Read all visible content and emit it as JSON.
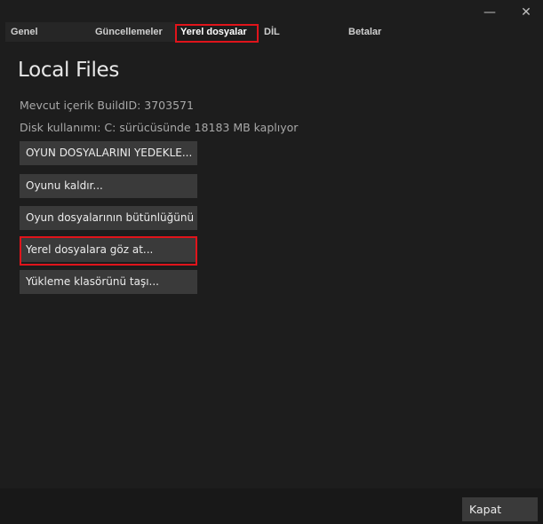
{
  "window": {
    "minimize_glyph": "—",
    "close_glyph": "✕"
  },
  "tabs": [
    {
      "label": "Genel"
    },
    {
      "label": "Güncellemeler"
    },
    {
      "label": "Yerel dosyalar"
    },
    {
      "label": "DİL"
    },
    {
      "label": "Betalar"
    }
  ],
  "selected_tab": "Yerel dosyalar",
  "page": {
    "title": "Local Files",
    "build_id_line": "Mevcut içerik BuildID: 3703571",
    "disk_usage_line": "Disk kullanımı: C: sürücüsünde 18183 MB kaplıyor"
  },
  "actions": [
    {
      "label": "OYUN DOSYALARINI YEDEKLE..."
    },
    {
      "label": "Oyunu kaldır..."
    },
    {
      "label": "Oyun dosyalarının bütünlüğünü doğrula..."
    },
    {
      "label": "Yerel dosyalara göz at..."
    },
    {
      "label": "Yükleme klasörünü taşı..."
    }
  ],
  "footer": {
    "close_label": "Kapat"
  },
  "colors": {
    "background": "#1d1d1d",
    "button": "#3a3a3a",
    "highlight": "#e0141b"
  }
}
